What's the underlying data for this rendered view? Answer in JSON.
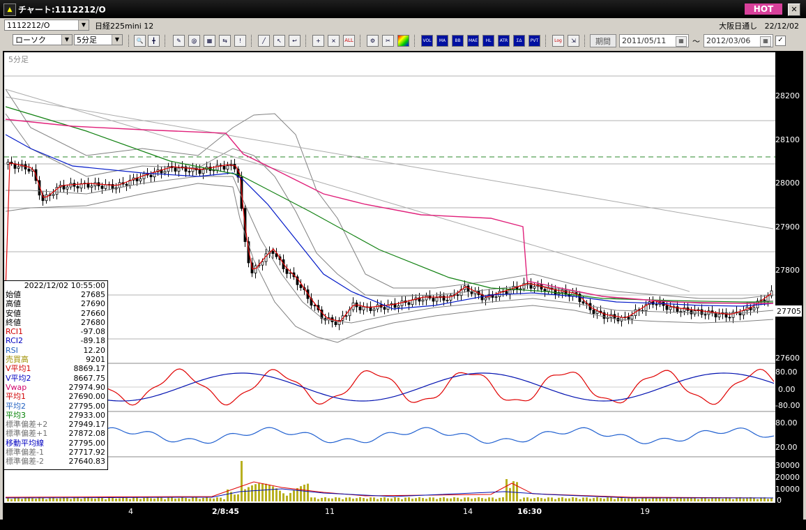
{
  "window": {
    "title": "チャート:1112212/O",
    "hot_label": "HOT",
    "close_glyph": "✕"
  },
  "row1": {
    "symbol_value": "1112212/O",
    "name": "日経225mini 12",
    "market": "大阪日通し",
    "date": "22/12/02"
  },
  "toolbar": {
    "chart_type": "ローソク",
    "timeframe": "5分足",
    "buttons": [
      "VOL",
      "MA",
      "BB",
      "MAE",
      "HL",
      "ATR",
      "ΣΔ",
      "PVT",
      "Log"
    ],
    "period_label": "期間",
    "date_from": "2011/05/11",
    "date_to": "2012/03/06",
    "tilde": "〜"
  },
  "chart": {
    "timeframe_label": "5分足",
    "price_labels": [
      "28200",
      "28100",
      "28000",
      "27900",
      "27800",
      "27600"
    ],
    "current_price": "27705",
    "rsi_labels": [
      "80.00",
      "0.00",
      "-80.00"
    ],
    "rsi2_labels": [
      "80.00",
      "20.00"
    ],
    "volume_labels": [
      "30000",
      "20000",
      "10000",
      "0"
    ],
    "x_labels": [
      "4",
      "2/8:45",
      "11",
      "14",
      "16:30",
      "19"
    ]
  },
  "info": {
    "timestamp": "2022/12/02  10:55:00",
    "rows": [
      {
        "label": "始値",
        "value": "27685",
        "color": "#000000"
      },
      {
        "label": "高値",
        "value": "27690",
        "color": "#000000"
      },
      {
        "label": "安値",
        "value": "27660",
        "color": "#000000"
      },
      {
        "label": "終値",
        "value": "27680",
        "color": "#000000"
      },
      {
        "label": "RCI1",
        "value": "-97.08",
        "color": "#d00000"
      },
      {
        "label": "RCI2",
        "value": "-89.18",
        "color": "#0000c0"
      },
      {
        "label": "RSI",
        "value": "12.20",
        "color": "#2060c0"
      },
      {
        "label": "売買高",
        "value": "9201",
        "color": "#a09000"
      },
      {
        "label": "V平均1",
        "value": "8869.17",
        "color": "#d00000"
      },
      {
        "label": "V平均2",
        "value": "8667.75",
        "color": "#0000c0"
      },
      {
        "label": "Vwap",
        "value": "27974.90",
        "color": "#d0006a"
      },
      {
        "label": "平均1",
        "value": "27690.00",
        "color": "#d00000"
      },
      {
        "label": "平均2",
        "value": "27795.00",
        "color": "#2060c0"
      },
      {
        "label": "平均3",
        "value": "27933.00",
        "color": "#008000"
      },
      {
        "label": "標準偏差+2",
        "value": "27949.17",
        "color": "#707070"
      },
      {
        "label": "標準偏差+1",
        "value": "27872.08",
        "color": "#707070"
      },
      {
        "label": "移動平均線",
        "value": "27795.00",
        "color": "#0000c0"
      },
      {
        "label": "標準偏差-1",
        "value": "27717.92",
        "color": "#707070"
      },
      {
        "label": "標準偏差-2",
        "value": "27640.83",
        "color": "#707070"
      }
    ]
  },
  "colors": {
    "chart_bg": "#ffffff",
    "ma1": "#e00000",
    "ma2": "#0018c8",
    "ma3": "#108010",
    "vwap": "#e0207a",
    "bands": "#808080",
    "volume": "#b8b020",
    "hot": "#d8409a"
  }
}
